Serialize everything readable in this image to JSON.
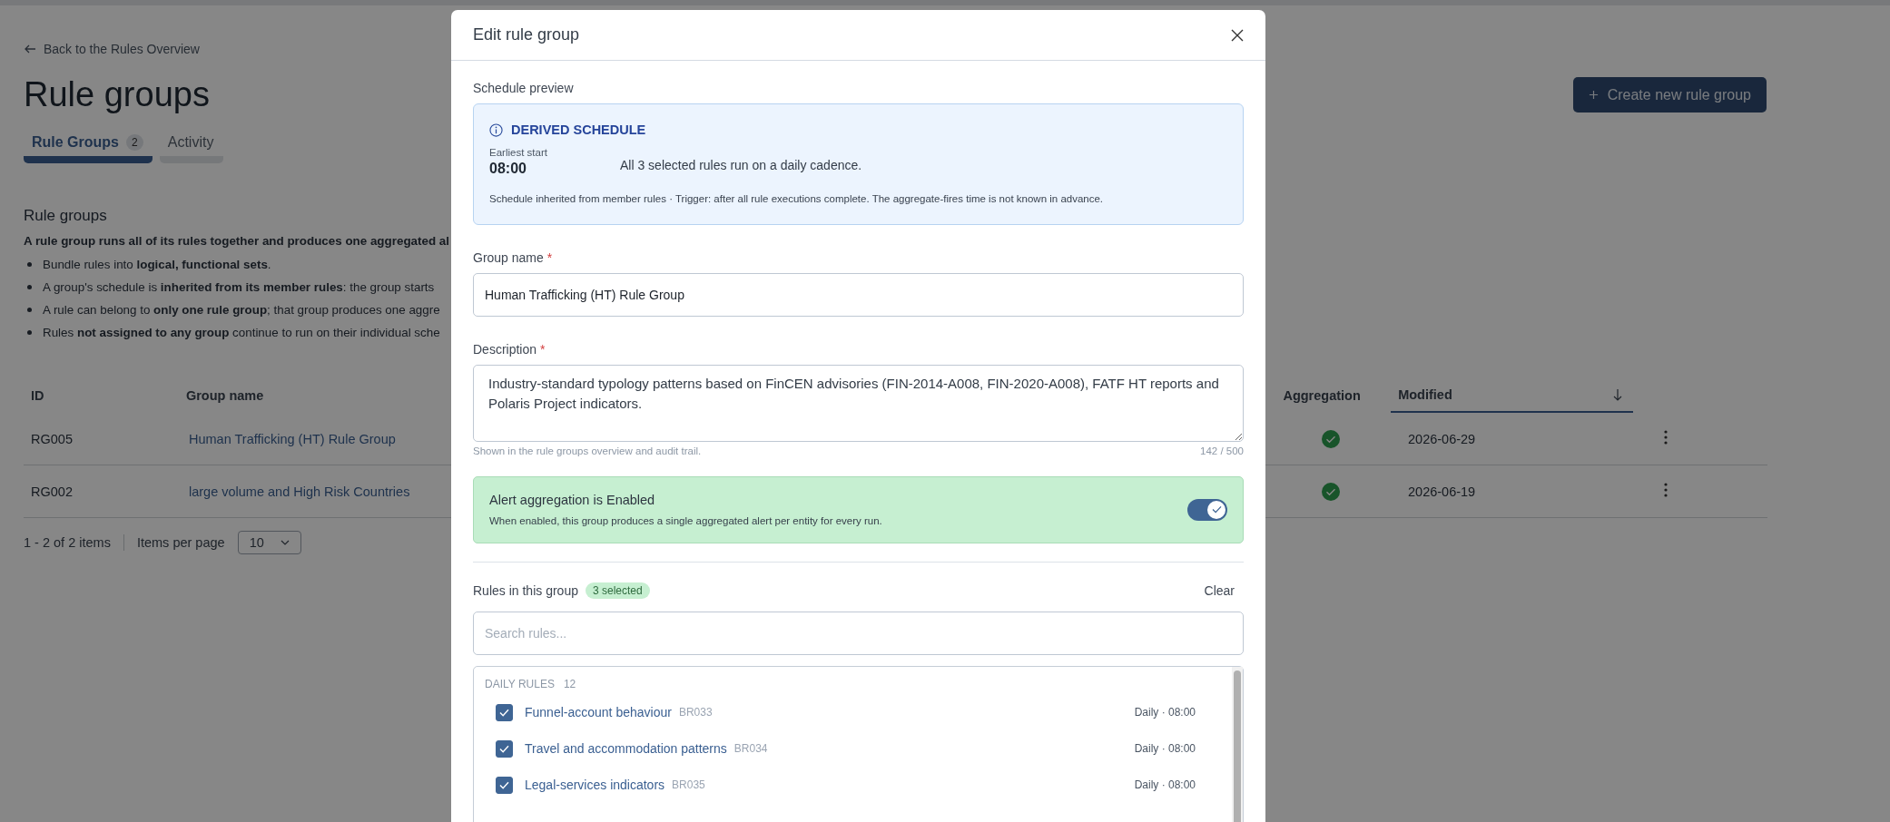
{
  "page": {
    "back_link": "Back to the Rules Overview",
    "title": "Rule groups",
    "create_button": "Create new rule group",
    "tabs": [
      {
        "label": "Rule Groups",
        "count": "2",
        "selected": true
      },
      {
        "label": "Activity",
        "selected": false
      }
    ],
    "section": {
      "heading": "Rule groups",
      "lead": "A rule group runs all of its rules together and produces one aggregated al",
      "bullets": [
        "Bundle rules into **logical, functional sets**.",
        "A group's schedule is **inherited from its member rules**: the group starts",
        "A rule can belong to **only one rule group**; that group produces one aggre",
        "Rules **not assigned to any group** continue to run on their individual sche"
      ]
    },
    "table": {
      "columns": [
        {
          "label": "ID",
          "sorted": false
        },
        {
          "label": "Group name",
          "sorted": false
        },
        {
          "label": "Aggregation",
          "sorted": false
        },
        {
          "label": "Modified",
          "sorted": true
        }
      ],
      "rows": [
        {
          "id": "RG005",
          "name": "Human Trafficking (HT) Rule Group",
          "aggregation": true,
          "modified": "2026-06-29"
        },
        {
          "id": "RG002",
          "name": "large volume and High Risk Countries",
          "aggregation": true,
          "modified": "2026-06-19"
        }
      ]
    },
    "pagination": {
      "range": "1 - 2 of 2 items",
      "per_page_label": "Items per page",
      "per_page": "10"
    }
  },
  "modal": {
    "title": "Edit rule group",
    "schedule_preview": {
      "label": "Schedule preview",
      "title": "DERIVED SCHEDULE",
      "earliest_label": "Earliest start",
      "earliest_value": "08:00",
      "summary": "All 3 selected rules run on a daily cadence.",
      "footnote": "Schedule inherited from member rules · Trigger: after all rule executions complete. The aggregate-fires time is not known in advance."
    },
    "group_name": {
      "label": "Group name",
      "required_mark": "*",
      "value": "Human Trafficking (HT) Rule Group"
    },
    "description": {
      "label": "Description",
      "required_mark": "*",
      "value": "Industry-standard typology patterns based on FinCEN advisories (FIN-2014-A008, FIN-2020-A008), FATF HT reports and Polaris Project indicators.",
      "hint": "Shown in the rule groups overview and audit trail.",
      "counter": "142 / 500"
    },
    "aggregation": {
      "title": "Alert aggregation is Enabled",
      "text": "When enabled, this group produces a single aggregated alert per entity for every run.",
      "on": true
    },
    "rules": {
      "label": "Rules in this group",
      "badge": "3 selected",
      "clear": "Clear",
      "search_placeholder": "Search rules...",
      "groups": [
        {
          "title": "DAILY RULES",
          "count": "12",
          "rules": [
            {
              "name": "Funnel-account behaviour",
              "code": "BR033",
              "schedule": "Daily · 08:00",
              "checked": true
            },
            {
              "name": "Travel and accommodation patterns",
              "code": "BR034",
              "schedule": "Daily · 08:00",
              "checked": true
            },
            {
              "name": "Legal-services indicators",
              "code": "BR035",
              "schedule": "Daily · 08:00",
              "checked": true
            }
          ]
        }
      ]
    }
  }
}
